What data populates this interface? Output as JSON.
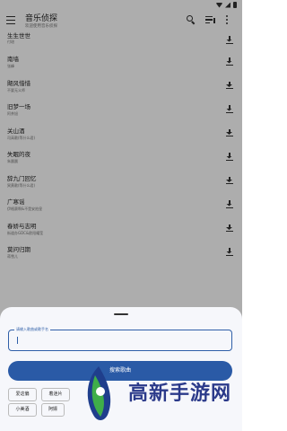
{
  "app_bar": {
    "title": "音乐侦探",
    "subtitle": "欢迎使用音乐侦探"
  },
  "songs": [
    {
      "title": "生生世世",
      "artist": "付瑄"
    },
    {
      "title": "南墙",
      "artist": "张峰"
    },
    {
      "title": "飓风惜惜",
      "artist": "不要无义师"
    },
    {
      "title": "旧梦一场",
      "artist": "阿茶旭"
    },
    {
      "title": "关山酒",
      "artist": "司高歌(等什么君)"
    },
    {
      "title": "失眠的夜",
      "artist": "朱晨晨"
    },
    {
      "title": "辞九门回忆",
      "artist": "冥黄歌(等什么君)"
    },
    {
      "title": "广寒谣",
      "artist": "伊格赛啊&不是安拍皇"
    },
    {
      "title": "春娇与志明",
      "artist": "街道办GDC&欧阳耀莹"
    },
    {
      "title": "莫问归期",
      "artist": "蒋雪儿"
    }
  ],
  "sheet": {
    "input_label": "请输入歌曲或歌手名",
    "input_value": "",
    "search_button": "搜索歌曲",
    "chips": [
      "爱这偏",
      "着迷片",
      "小美酒",
      "阿嫖"
    ]
  },
  "icons": {
    "menu": "menu-icon",
    "search": "search-icon",
    "queue": "queue-music-icon",
    "more": "more-vert-icon",
    "download": "download-icon"
  },
  "colors": {
    "accent": "#2a5aa6",
    "scrim": "rgba(0,0,0,0.32)",
    "sheet_bg": "#f6f7fb",
    "watermark": "#2b3a8a"
  },
  "watermark": {
    "text": "高新手游网"
  }
}
